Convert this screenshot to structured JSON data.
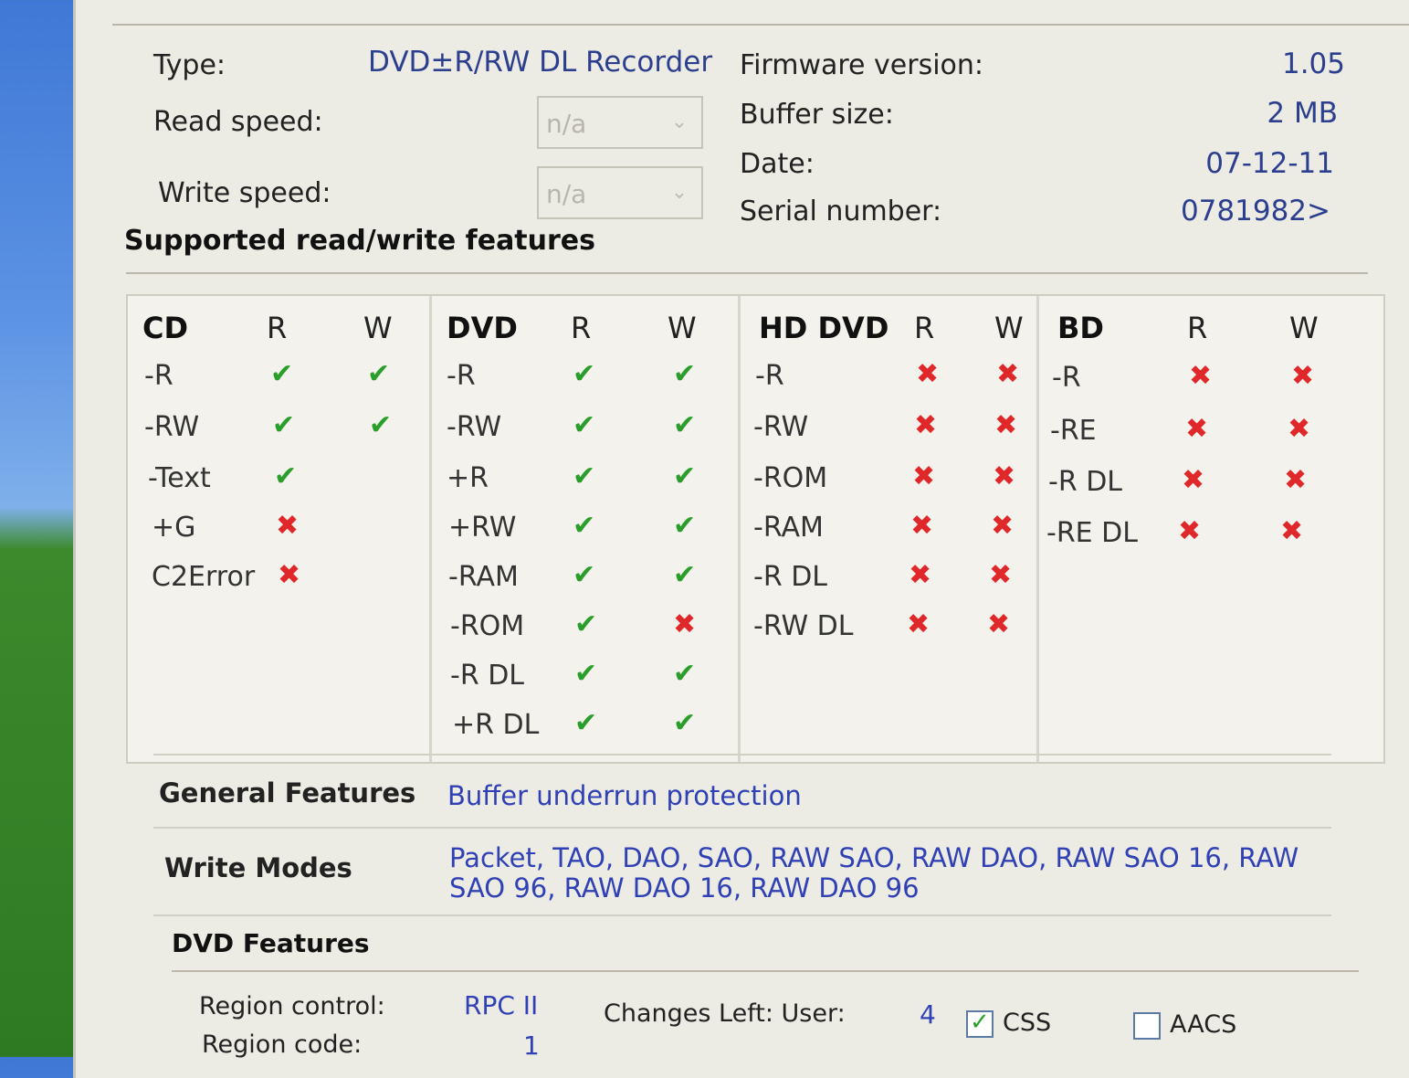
{
  "general": {
    "type_label": "Type:",
    "type_value": "DVD±R/RW DL Recorder",
    "read_speed_label": "Read speed:",
    "read_speed_value": "n/a",
    "write_speed_label": "Write speed:",
    "write_speed_value": "n/a",
    "firmware_label": "Firmware version:",
    "firmware_value": "1.05",
    "buffer_label": "Buffer size:",
    "buffer_value": "2 MB",
    "date_label": "Date:",
    "date_value": "07-12-11",
    "serial_label": "Serial number:",
    "serial_value": "0781982>"
  },
  "features_title": "Supported read/write features",
  "columns": [
    {
      "name": "CD",
      "r": "R",
      "w": "W",
      "rows": [
        {
          "label": "-R",
          "r": "yes",
          "w": "yes"
        },
        {
          "label": "-RW",
          "r": "yes",
          "w": "yes"
        },
        {
          "label": "-Text",
          "r": "yes",
          "w": ""
        },
        {
          "label": "+G",
          "r": "no",
          "w": ""
        },
        {
          "label": "C2Error",
          "r": "no",
          "w": ""
        }
      ]
    },
    {
      "name": "DVD",
      "r": "R",
      "w": "W",
      "rows": [
        {
          "label": "-R",
          "r": "yes",
          "w": "yes"
        },
        {
          "label": "-RW",
          "r": "yes",
          "w": "yes"
        },
        {
          "label": "+R",
          "r": "yes",
          "w": "yes"
        },
        {
          "label": "+RW",
          "r": "yes",
          "w": "yes"
        },
        {
          "label": "-RAM",
          "r": "yes",
          "w": "yes"
        },
        {
          "label": "-ROM",
          "r": "yes",
          "w": "no"
        },
        {
          "label": "-R DL",
          "r": "yes",
          "w": "yes"
        },
        {
          "label": "+R DL",
          "r": "yes",
          "w": "yes"
        }
      ]
    },
    {
      "name": "HD DVD",
      "r": "R",
      "w": "W",
      "rows": [
        {
          "label": "-R",
          "r": "no",
          "w": "no"
        },
        {
          "label": "-RW",
          "r": "no",
          "w": "no"
        },
        {
          "label": "-ROM",
          "r": "no",
          "w": "no"
        },
        {
          "label": "-RAM",
          "r": "no",
          "w": "no"
        },
        {
          "label": "-R DL",
          "r": "no",
          "w": "no"
        },
        {
          "label": "-RW DL",
          "r": "no",
          "w": "no"
        }
      ]
    },
    {
      "name": "BD",
      "r": "R",
      "w": "W",
      "rows": [
        {
          "label": "-R",
          "r": "no",
          "w": "no"
        },
        {
          "label": "-RE",
          "r": "no",
          "w": "no"
        },
        {
          "label": "-R DL",
          "r": "no",
          "w": "no"
        },
        {
          "label": "-RE DL",
          "r": "no",
          "w": "no"
        }
      ]
    }
  ],
  "general_features_label": "General Features",
  "general_features_value": "Buffer underrun protection",
  "write_modes_label": "Write Modes",
  "write_modes_line1": "Packet, TAO, DAO, SAO, RAW SAO, RAW DAO, RAW SAO 16, RAW",
  "write_modes_line2": "SAO 96, RAW DAO 16, RAW DAO 96",
  "dvd_features_title": "DVD Features",
  "dvd": {
    "region_control_label": "Region control:",
    "region_control_value": "RPC II",
    "changes_left_label": "Changes Left: User:",
    "changes_left_value": "4",
    "css_label": "CSS",
    "css_checked": true,
    "aacs_label": "AACS",
    "aacs_checked": false,
    "region_code_label": "Region code:",
    "region_code_value": "1"
  },
  "colors": {
    "check": "#2a9e2a",
    "cross": "#e0282a",
    "value_blue": "#2c3f8f",
    "link_blue": "#2f41b4"
  }
}
